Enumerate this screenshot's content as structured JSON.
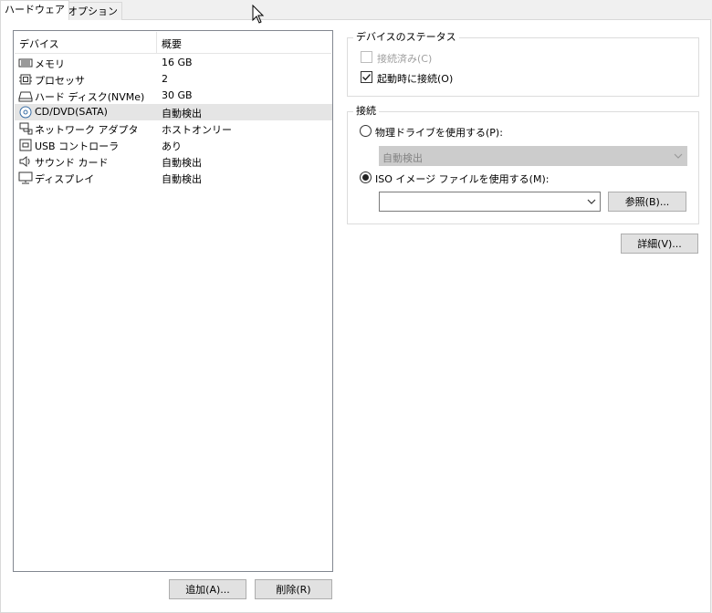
{
  "tabs": [
    {
      "label": "ハードウェア",
      "active": true
    },
    {
      "label": "オプション",
      "active": false
    }
  ],
  "device_list": {
    "columns": [
      "デバイス",
      "概要"
    ],
    "rows": [
      {
        "icon": "memory-icon",
        "name": "メモリ",
        "summary": "16 GB"
      },
      {
        "icon": "processor-icon",
        "name": "プロセッサ",
        "summary": "2"
      },
      {
        "icon": "hard-disk-icon",
        "name": "ハード ディスク(NVMe)",
        "summary": "30 GB"
      },
      {
        "icon": "cd-dvd-icon",
        "name": "CD/DVD(SATA)",
        "summary": "自動検出",
        "selected": true
      },
      {
        "icon": "network-adapter-icon",
        "name": "ネットワーク アダプタ",
        "summary": "ホストオンリー"
      },
      {
        "icon": "usb-controller-icon",
        "name": "USB コントローラ",
        "summary": "あり"
      },
      {
        "icon": "sound-card-icon",
        "name": "サウンド カード",
        "summary": "自動検出"
      },
      {
        "icon": "display-icon",
        "name": "ディスプレイ",
        "summary": "自動検出"
      }
    ]
  },
  "buttons": {
    "add": "追加(A)...",
    "remove": "削除(R)",
    "browse": "参照(B)...",
    "details": "詳細(V)..."
  },
  "device_status": {
    "title": "デバイスのステータス",
    "connected": {
      "label": "接続済み(C)",
      "checked": false,
      "disabled": true
    },
    "connect_at_power_on": {
      "label": "起動時に接続(O)",
      "checked": true
    }
  },
  "connection": {
    "title": "接続",
    "physical_drive": {
      "label": "物理ドライブを使用する(P):",
      "selected": false,
      "value": "自動検出"
    },
    "iso_image": {
      "label": "ISO イメージ ファイルを使用する(M):",
      "selected": true,
      "value": ""
    }
  }
}
